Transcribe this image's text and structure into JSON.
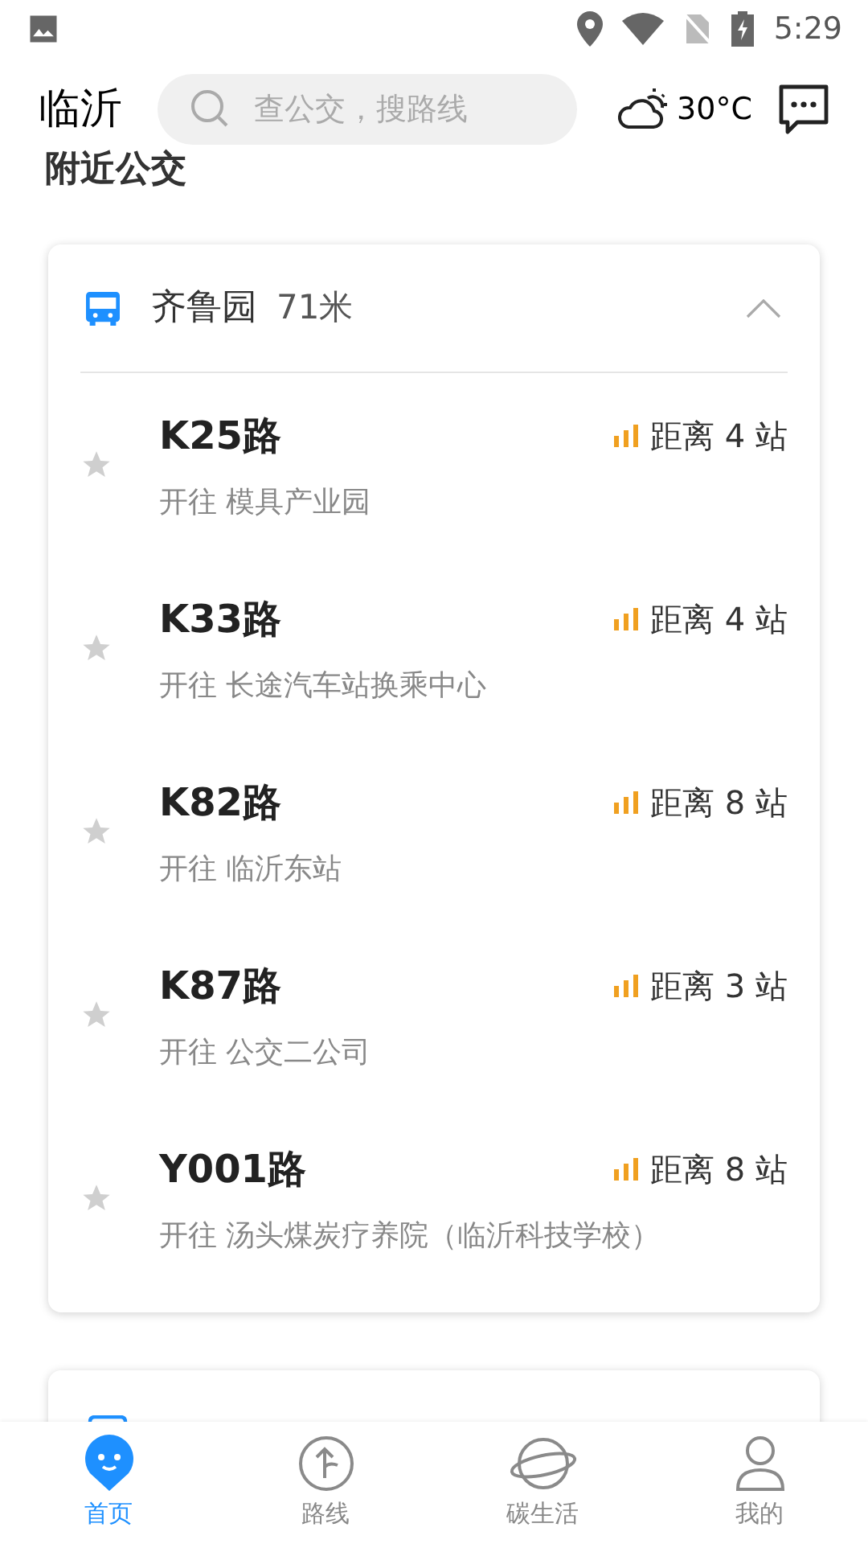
{
  "status_bar": {
    "time": "5:29"
  },
  "header": {
    "city": "临沂",
    "search": {
      "placeholder": "查公交，搜路线"
    },
    "temperature": "30°C"
  },
  "section_title": "附近公交",
  "stop": {
    "name": "齐鲁园",
    "distance": "71米",
    "expanded": true,
    "routes": [
      {
        "name": "K25路",
        "direction": "开往 模具产业园",
        "stations": "距离 4 站",
        "favorite": false
      },
      {
        "name": "K33路",
        "direction": "开往 长途汽车站换乘中心",
        "stations": "距离 4 站",
        "favorite": false
      },
      {
        "name": "K82路",
        "direction": "开往 临沂东站",
        "stations": "距离 8 站",
        "favorite": false
      },
      {
        "name": "K87路",
        "direction": "开往 公交二公司",
        "stations": "距离 3 站",
        "favorite": false
      },
      {
        "name": "Y001路",
        "direction": "开往 汤头煤炭疗养院（临沂科技学校）",
        "stations": "距离 8 站",
        "favorite": false
      }
    ]
  },
  "nav": [
    {
      "kind": "home",
      "label": "首页",
      "selected": true
    },
    {
      "kind": "route",
      "label": "路线",
      "selected": false
    },
    {
      "kind": "planet",
      "label": "碳生活",
      "selected": false
    },
    {
      "kind": "person",
      "label": "我的",
      "selected": false
    }
  ]
}
